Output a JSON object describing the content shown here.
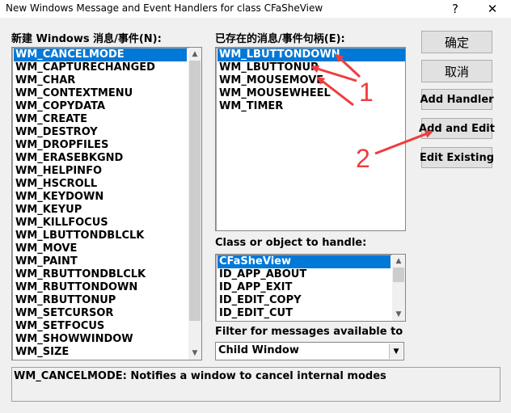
{
  "window": {
    "title": "New Windows Message and Event Handlers for class CFaSheView",
    "help_glyph": "?",
    "close_glyph": "✕"
  },
  "new_messages": {
    "label": "新建 Windows 消息/事件(N):",
    "items": [
      "WM_CANCELMODE",
      "WM_CAPTURECHANGED",
      "WM_CHAR",
      "WM_CONTEXTMENU",
      "WM_COPYDATA",
      "WM_CREATE",
      "WM_DESTROY",
      "WM_DROPFILES",
      "WM_ERASEBKGND",
      "WM_HELPINFO",
      "WM_HSCROLL",
      "WM_KEYDOWN",
      "WM_KEYUP",
      "WM_KILLFOCUS",
      "WM_LBUTTONDBLCLK",
      "WM_MOVE",
      "WM_PAINT",
      "WM_RBUTTONDBLCLK",
      "WM_RBUTTONDOWN",
      "WM_RBUTTONUP",
      "WM_SETCURSOR",
      "WM_SETFOCUS",
      "WM_SHOWWINDOW",
      "WM_SIZE"
    ],
    "selected": "WM_CANCELMODE"
  },
  "existing_handlers": {
    "label": "已存在的消息/事件句柄(E):",
    "items": [
      "WM_LBUTTONDOWN",
      "WM_LBUTTONUP",
      "WM_MOUSEMOVE",
      "WM_MOUSEWHEEL",
      "WM_TIMER"
    ],
    "selected": "WM_LBUTTONDOWN"
  },
  "class_object": {
    "label": "Class or object to handle:",
    "items": [
      "CFaSheView",
      "ID_APP_ABOUT",
      "ID_APP_EXIT",
      "ID_EDIT_COPY",
      "ID_EDIT_CUT"
    ],
    "selected": "CFaSheView"
  },
  "filter": {
    "label": "Filter for messages available to",
    "value": "Child Window"
  },
  "buttons": {
    "ok": "确定",
    "cancel": "取消",
    "add_handler": "Add Handler",
    "add_and_edit": "Add and Edit",
    "edit_existing": "Edit Existing"
  },
  "status": {
    "text": "WM_CANCELMODE:  Notifies a window to cancel internal modes"
  },
  "annotations": {
    "label_1": "1",
    "label_2": "2",
    "color": "#f03c3c"
  },
  "icons": {
    "scroll_up": "▲",
    "scroll_down": "▼",
    "combo_arrow": "▼"
  }
}
